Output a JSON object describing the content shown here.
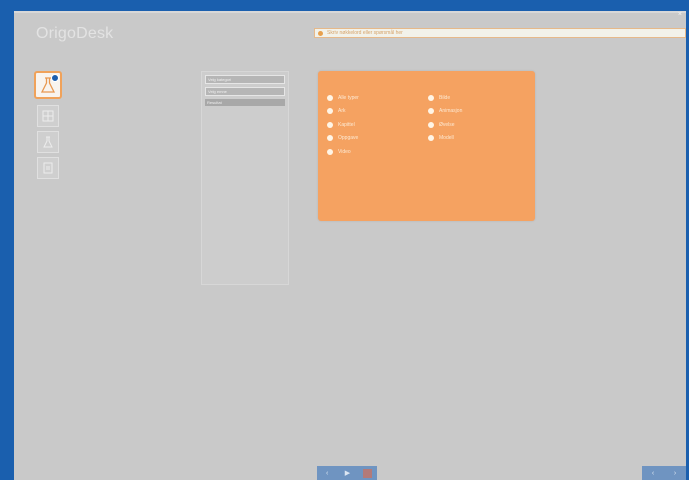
{
  "app": {
    "logo_text": "OrigoDesk",
    "close_label": "×"
  },
  "search": {
    "text": "Skriv nøkkelord eller spørsmål her"
  },
  "toolbar": {
    "items": [
      {
        "icon": "flask-icon",
        "active": true
      },
      {
        "icon": "grid-icon",
        "active": false
      },
      {
        "icon": "beaker-icon",
        "active": false
      },
      {
        "icon": "page-icon",
        "active": false
      }
    ]
  },
  "list_panel": {
    "rows": [
      {
        "label": "Velg kategori",
        "kind": "item"
      },
      {
        "label": "Velg emne",
        "kind": "item"
      },
      {
        "label": "Resultat",
        "kind": "selected"
      }
    ]
  },
  "options_panel": {
    "left": [
      "Alle typer",
      "Ark",
      "Kapittel",
      "Oppgave",
      "Video"
    ],
    "right": [
      "Bilde",
      "Animasjon",
      "Øvelse",
      "Modell"
    ]
  },
  "bottom_nav": {
    "prev": "‹",
    "play": "▶",
    "next": "›"
  },
  "bottom_right": {
    "a": "‹",
    "b": "›"
  },
  "colors": {
    "frame": "#1a5fae",
    "background": "#c9c9c9",
    "accent": "#f5a261"
  }
}
